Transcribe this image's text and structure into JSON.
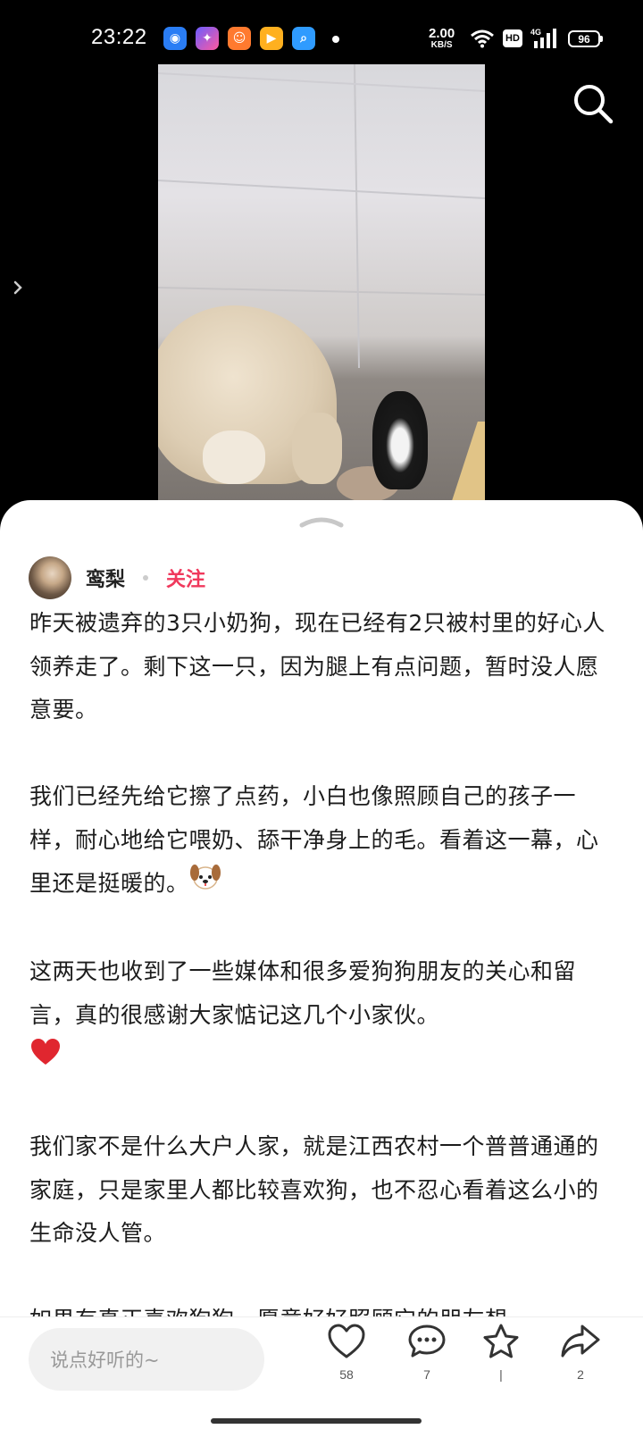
{
  "status_bar": {
    "time": "23:22",
    "net_speed": "2.00",
    "net_unit": "KB/S",
    "hd": "HD",
    "network": "4G",
    "battery": "96",
    "app_icons": [
      "browser-app-icon",
      "star-app-icon",
      "game-app-icon",
      "video-app-icon",
      "search-app-icon"
    ]
  },
  "post": {
    "author": "鸾梨",
    "follow_label": "关注",
    "paragraphs": [
      "昨天被遗弃的3只小奶狗，现在已经有2只被村里的好心人领养走了。剩下这一只，因为腿上有点问题，暂时没人愿意要。",
      "我们已经先给它擦了点药，小白也像照顾自己的孩子一样，耐心地给它喂奶、舔干净身上的毛。看着这一幕，心里还是挺暖的。",
      "这两天也收到了一些媒体和很多爱狗狗朋友的关心和留言，真的很感谢大家惦记这几个小家伙。",
      "我们家不是什么大户人家，就是江西农村一个普普通通的家庭，只是家里人都比较喜欢狗，也不忍心看着这么小的生命没人管。",
      "如果有真正喜欢狗狗、愿意好好照顾它的朋友想"
    ]
  },
  "bottom_bar": {
    "comment_placeholder": "说点好听的~",
    "like_count": "58",
    "comment_count": "7",
    "collect_count": "|",
    "share_count": "2"
  },
  "colors": {
    "accent": "#f0385c",
    "heart_emoji": "#e0262f"
  }
}
